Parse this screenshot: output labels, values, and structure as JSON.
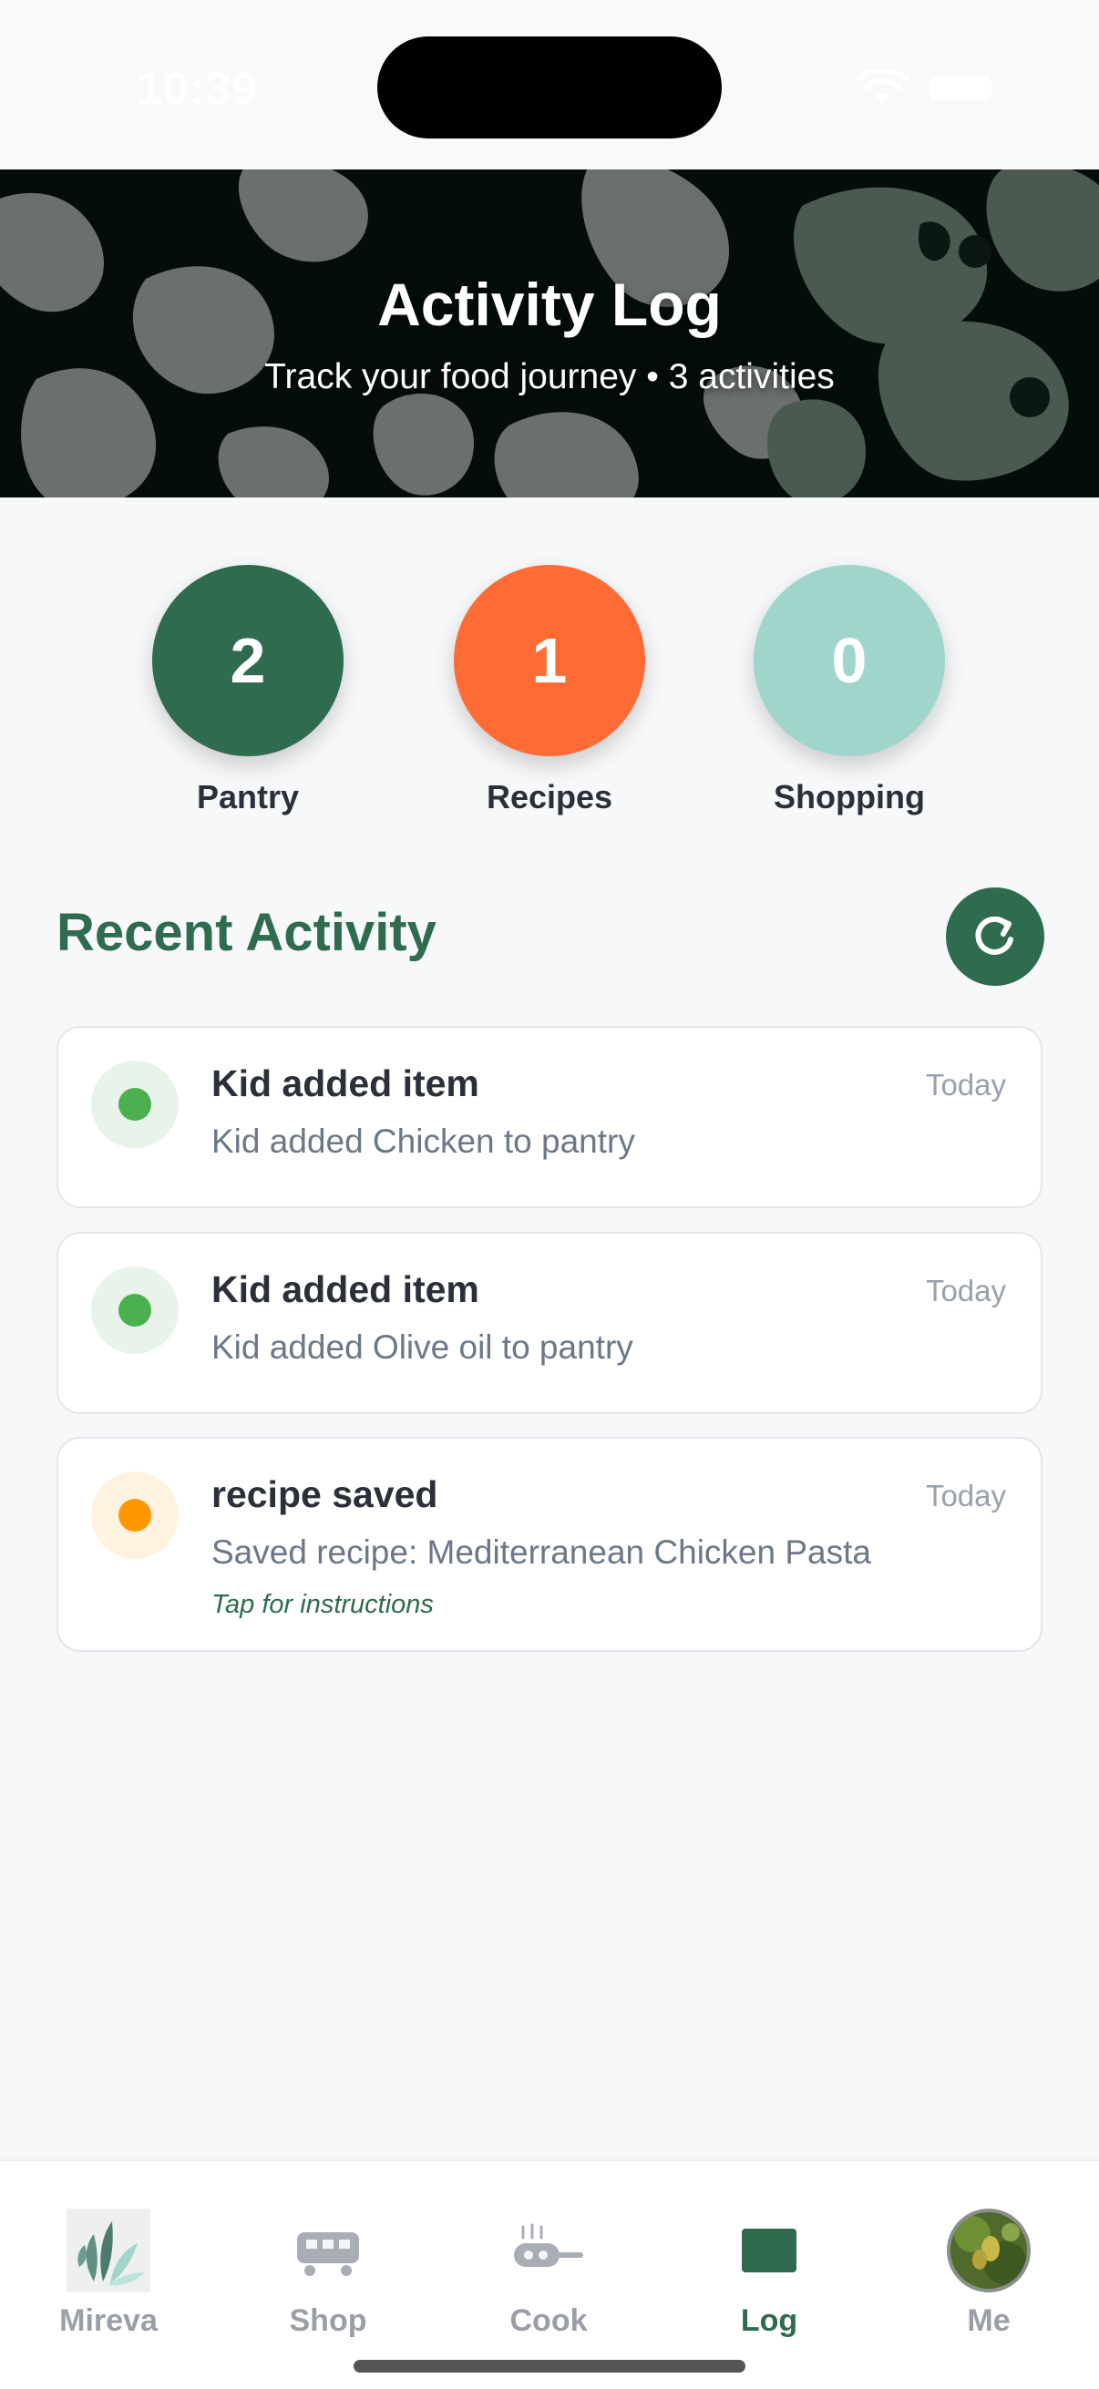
{
  "status_bar": {
    "time": "10:39"
  },
  "header": {
    "title": "Activity Log",
    "subtitle": "Track your food journey • 3 activities"
  },
  "stats": [
    {
      "value": "2",
      "label": "Pantry",
      "color": "#2e6b4f"
    },
    {
      "value": "1",
      "label": "Recipes",
      "color": "#ff6b35"
    },
    {
      "value": "0",
      "label": "Shopping",
      "color": "#a0d5cc"
    }
  ],
  "recent": {
    "title": "Recent Activity",
    "refresh_icon": "refresh-icon"
  },
  "activities": [
    {
      "title": "Kid added item",
      "time": "Today",
      "description": "Kid added Chicken to pantry",
      "hint": "",
      "dot_color": "#4caf50",
      "dot_bg": "#e8f3ea"
    },
    {
      "title": "Kid added item",
      "time": "Today",
      "description": "Kid added Olive oil to pantry",
      "hint": "",
      "dot_color": "#4caf50",
      "dot_bg": "#e8f3ea"
    },
    {
      "title": "recipe saved",
      "time": "Today",
      "description": "Saved recipe: Mediterranean Chicken Pasta",
      "hint": "Tap for instructions",
      "dot_color": "#ff9800",
      "dot_bg": "#fff3e0"
    }
  ],
  "tab_bar": {
    "tabs": [
      {
        "label": "Mireva",
        "icon": "mireva-logo-icon"
      },
      {
        "label": "Shop",
        "icon": "cart-icon"
      },
      {
        "label": "Cook",
        "icon": "pan-icon"
      },
      {
        "label": "Log",
        "icon": "log-icon"
      },
      {
        "label": "Me",
        "icon": "avatar"
      }
    ],
    "active": "Log"
  }
}
